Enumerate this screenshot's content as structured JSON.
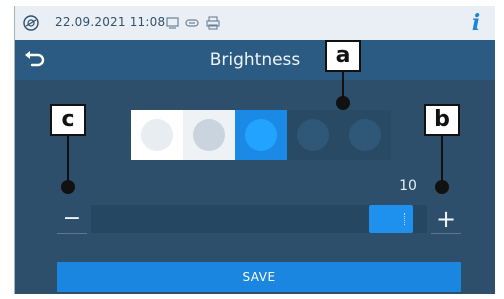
{
  "statusbar": {
    "datetime": "22.09.2021  11:08",
    "icons": [
      "device-logo-icon",
      "monitor-icon",
      "usb-stick-icon",
      "printer-icon"
    ],
    "info_icon": "i"
  },
  "titlebar": {
    "back_icon": "back-arrow-icon",
    "title": "Brightness"
  },
  "brightness": {
    "swatch_levels": [
      {
        "bg": "#ffffff",
        "dot": "#e8edf1"
      },
      {
        "bg": "#eef2f5",
        "dot": "#c9d4de"
      },
      {
        "bg": "#1a8ae6",
        "dot": "#22a3ff"
      },
      {
        "bg": "#284a64",
        "dot": "#2f5878"
      },
      {
        "bg": "#284a64",
        "dot": "#2f5878"
      }
    ],
    "selected_index": 2,
    "value_label": "10",
    "value_fraction": 1.0,
    "minus_label": "−",
    "plus_label": "+"
  },
  "save_label": "SAVE",
  "callouts": {
    "a": "a",
    "b": "b",
    "c": "c"
  }
}
